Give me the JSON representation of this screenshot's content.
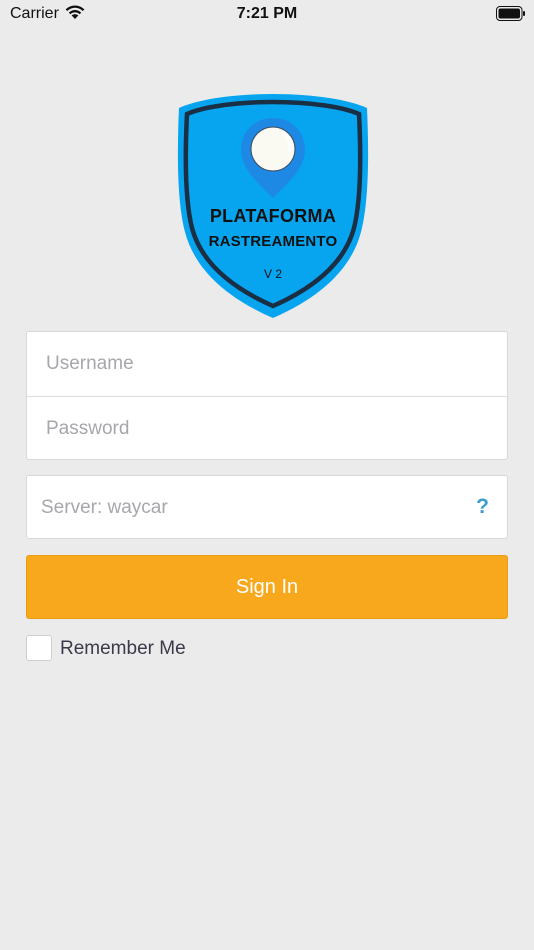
{
  "status_bar": {
    "carrier": "Carrier",
    "time": "7:21 PM"
  },
  "logo": {
    "line1": "PLATAFORMA",
    "line2": "RASTREAMENTO",
    "version": "V 2",
    "colors": {
      "shield_fill": "#07a5f0",
      "shield_outline": "#1a2e44",
      "pin": "#1e88e5"
    }
  },
  "login": {
    "username_placeholder": "Username",
    "password_placeholder": "Password",
    "server_placeholder": "Server: waycar",
    "help_label": "?",
    "signin_label": "Sign In",
    "remember_label": "Remember Me",
    "remember_checked": false
  },
  "colors": {
    "background": "#ebebeb",
    "accent": "#f7a81c",
    "help": "#3e9bcf"
  }
}
